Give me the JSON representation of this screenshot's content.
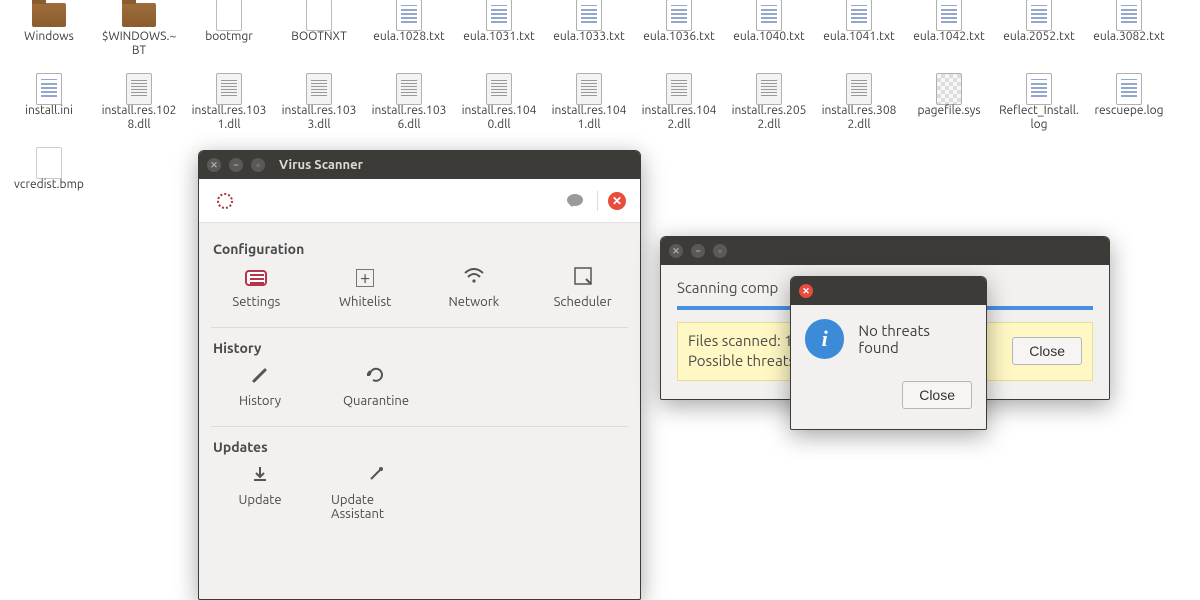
{
  "desktop": {
    "items": [
      {
        "label": "Windows",
        "icon": "folder"
      },
      {
        "label": "$WINDOWS.~BT",
        "icon": "folder"
      },
      {
        "label": "bootmgr",
        "icon": "blank"
      },
      {
        "label": "BOOTNXT",
        "icon": "blank"
      },
      {
        "label": "eula.1028.txt",
        "icon": "text"
      },
      {
        "label": "eula.1031.txt",
        "icon": "text"
      },
      {
        "label": "eula.1033.txt",
        "icon": "text"
      },
      {
        "label": "eula.1036.txt",
        "icon": "text"
      },
      {
        "label": "eula.1040.txt",
        "icon": "text"
      },
      {
        "label": "eula.1041.txt",
        "icon": "text"
      },
      {
        "label": "eula.1042.txt",
        "icon": "text"
      },
      {
        "label": "eula.2052.txt",
        "icon": "text"
      },
      {
        "label": "eula.3082.txt",
        "icon": "text"
      },
      {
        "label": "install.ini",
        "icon": "text"
      },
      {
        "label": "install.res.1028.dll",
        "icon": "doc"
      },
      {
        "label": "install.res.1031.dll",
        "icon": "doc"
      },
      {
        "label": "install.res.1033.dll",
        "icon": "doc"
      },
      {
        "label": "install.res.1036.dll",
        "icon": "doc"
      },
      {
        "label": "install.res.1040.dll",
        "icon": "doc"
      },
      {
        "label": "install.res.1041.dll",
        "icon": "doc"
      },
      {
        "label": "install.res.1042.dll",
        "icon": "doc"
      },
      {
        "label": "install.res.2052.dll",
        "icon": "doc"
      },
      {
        "label": "install.res.3082.dll",
        "icon": "doc"
      },
      {
        "label": "pagefile.sys",
        "icon": "grid"
      },
      {
        "label": "Reflect_Install.log",
        "icon": "text"
      },
      {
        "label": "rescuepe.log",
        "icon": "text"
      },
      {
        "label": "vcredist.bmp",
        "icon": "bmp"
      }
    ]
  },
  "scanner": {
    "title": "Virus Scanner",
    "sections": {
      "configuration": {
        "title": "Configuration",
        "items": [
          {
            "label": "Settings",
            "icon": "settings"
          },
          {
            "label": "Whitelist",
            "icon": "plus"
          },
          {
            "label": "Network",
            "icon": "wifi"
          },
          {
            "label": "Scheduler",
            "icon": "scheduler"
          }
        ]
      },
      "history": {
        "title": "History",
        "items": [
          {
            "label": "History",
            "icon": "pencil"
          },
          {
            "label": "Quarantine",
            "icon": "cycle"
          }
        ]
      },
      "updates": {
        "title": "Updates",
        "items": [
          {
            "label": "Update",
            "icon": "download"
          },
          {
            "label": "Update Assistant",
            "icon": "wand"
          }
        ]
      }
    }
  },
  "scan_result": {
    "status_partial": "Scanning comp",
    "files_scanned_label": "Files scanned: 1",
    "threats_label_partial": "Possible threats",
    "close_label": "Close"
  },
  "info_dialog": {
    "message": "No threats found",
    "close_label": "Close"
  }
}
